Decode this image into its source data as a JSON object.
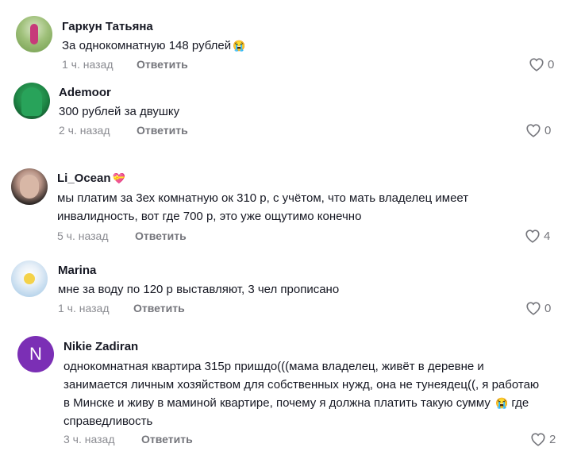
{
  "comments": [
    {
      "author": "Гаркун Татьяна",
      "text": "За однокомнатную 148 рублей",
      "emoji": "😭",
      "time": "1 ч. назад",
      "reply": "Ответить",
      "likes": "0"
    },
    {
      "author": "Ademoor",
      "text": "300 рублей за двушку",
      "time": "2 ч. назад",
      "reply": "Ответить",
      "likes": "0"
    },
    {
      "author": "Li_Ocean",
      "badge": "💝",
      "text_lines": [
        "мы платим за 3ех комнатную ок 310 р, с учётом, что мать владелец имеет",
        "инвалидность, вот где 700 р, это уже ощутимо конечно"
      ],
      "time": "5 ч. назад",
      "reply": "Ответить",
      "likes": "4"
    },
    {
      "author": "Marina",
      "text": "мне за воду по 120 р выставляют, 3 чел прописано",
      "time": "1 ч. назад",
      "reply": "Ответить",
      "likes": "0"
    },
    {
      "author": "Nikie Zadiran",
      "avatar_letter": "N",
      "text_lines": [
        "однокомнатная квартира 315р пришдо(((мама владелец, живёт в деревне и",
        "занимается личным хозяйством для собственных нужд, она не тунеядец((, я работаю",
        "в Минске и живу в маминой квартире, почему я должна платить такую сумму",
        "справедливость"
      ],
      "emoji": "😭",
      "emoji_after": "где",
      "time": "3 ч. назад",
      "reply": "Ответить",
      "likes": "2"
    }
  ],
  "colors": {
    "accent_avatar_n": "#7b2fb5",
    "muted": "#8a8b91"
  }
}
